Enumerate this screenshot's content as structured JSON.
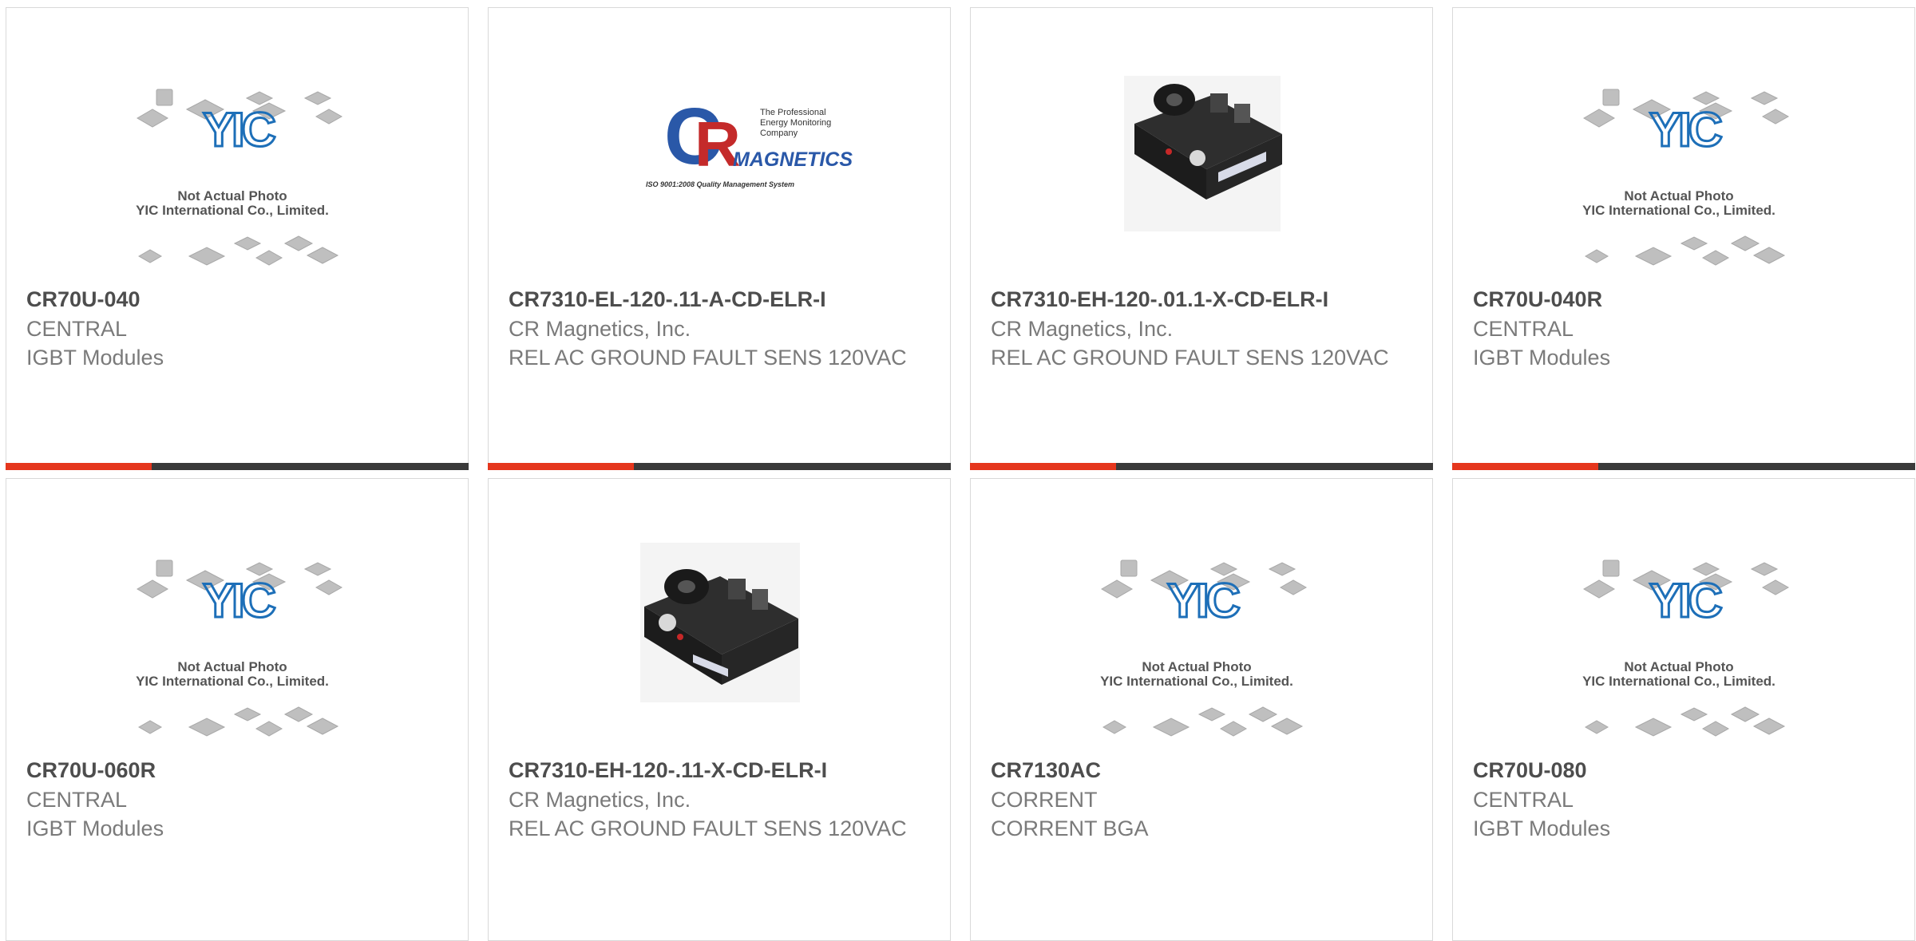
{
  "brand": {
    "yic_logo_text": "YIC",
    "placeholder_line1": "Not Actual Photo",
    "placeholder_line2": "YIC International Co., Limited.",
    "crm_lines": [
      "The Professional",
      "Energy Monitoring",
      "Company"
    ],
    "crm_magnetics": "MAGNETICS",
    "crm_iso": "ISO 9001:2008 Quality Management System"
  },
  "colors": {
    "accent": "#e5361d",
    "bar": "#3a3a3a",
    "title": "#4d4d4d",
    "text": "#7a7a7a",
    "border": "#d9d9d9"
  },
  "products": [
    {
      "image": "yic-placeholder",
      "part": "CR70U-040",
      "maker": "CENTRAL",
      "desc": "IGBT Modules"
    },
    {
      "image": "cr-magnetics-logo",
      "part": "CR7310-EL-120-.11-A-CD-ELR-I",
      "maker": "CR Magnetics, Inc.",
      "desc": "REL AC GROUND FAULT SENS 120VAC"
    },
    {
      "image": "relay-photo",
      "part": "CR7310-EH-120-.01.1-X-CD-ELR-I",
      "maker": "CR Magnetics, Inc.",
      "desc": "REL AC GROUND FAULT SENS 120VAC"
    },
    {
      "image": "yic-placeholder",
      "part": "CR70U-040R",
      "maker": "CENTRAL",
      "desc": "IGBT Modules"
    },
    {
      "image": "yic-placeholder",
      "part": "CR70U-060R",
      "maker": "CENTRAL",
      "desc": "IGBT Modules"
    },
    {
      "image": "relay-photo",
      "part": "CR7310-EH-120-.11-X-CD-ELR-I",
      "maker": "CR Magnetics, Inc.",
      "desc": "REL AC GROUND FAULT SENS 120VAC"
    },
    {
      "image": "yic-placeholder",
      "part": "CR7130AC",
      "maker": "CORRENT",
      "desc": "CORRENT BGA"
    },
    {
      "image": "yic-placeholder",
      "part": "CR70U-080",
      "maker": "CENTRAL",
      "desc": "IGBT Modules"
    }
  ]
}
